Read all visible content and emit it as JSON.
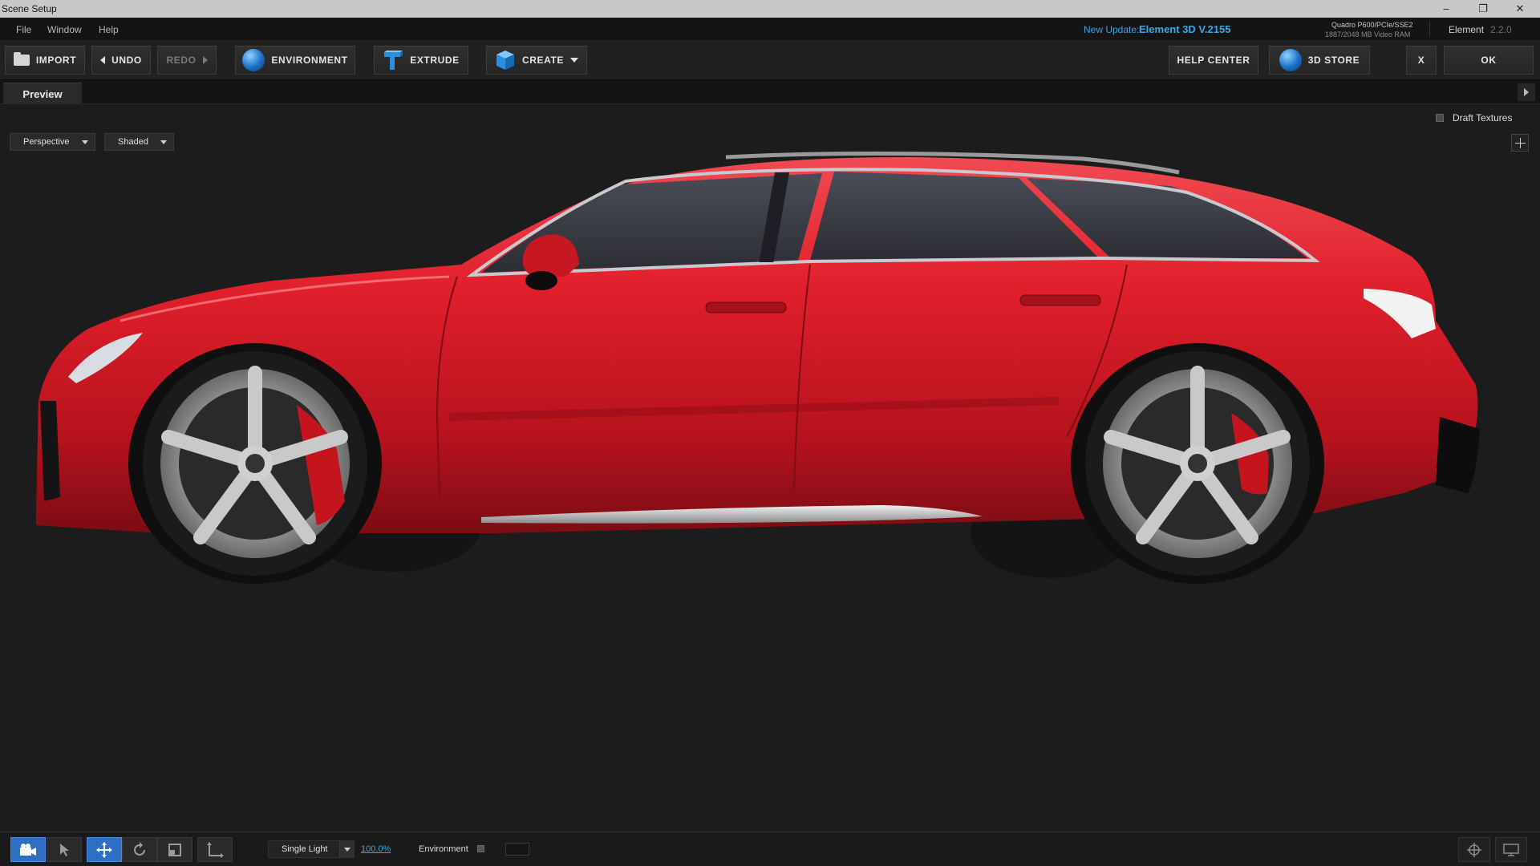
{
  "window": {
    "title": "Scene Setup",
    "minimize_symbol": "–",
    "restore_symbol": "❐",
    "close_symbol": "✕"
  },
  "menu": {
    "items": [
      "File",
      "Window",
      "Help"
    ],
    "update_label": "New Update:",
    "update_version": "Element 3D V.2155",
    "gpu_name": "Quadro P600/PCIe/SSE2",
    "gpu_ram": "1887/2048 MB Video RAM",
    "element_name": "Element",
    "element_version": "2.2.0"
  },
  "toolbar": {
    "import": "IMPORT",
    "undo": "UNDO",
    "redo": "REDO",
    "environment": "ENVIRONMENT",
    "extrude": "EXTRUDE",
    "create": "CREATE",
    "help_center": "HELP CENTER",
    "store": "3D STORE",
    "close": "X",
    "ok": "OK"
  },
  "tabs": {
    "preview": "Preview"
  },
  "viewport": {
    "draft_textures_label": "Draft Textures",
    "draft_textures_checked": false,
    "camera_view": "Perspective",
    "shading_mode": "Shaded",
    "car_body_color": "#d61b27"
  },
  "bottom": {
    "tools": [
      "camera-icon",
      "select-arrow-icon",
      "move-icon",
      "rotate-icon",
      "scale-icon",
      "axis-icon"
    ],
    "active_tool": "move-icon",
    "light_mode": "Single Light",
    "light_percent": "100.0%",
    "environment_label": "Environment",
    "environment_checked": false
  },
  "colors": {
    "accent_blue": "#3aa7e6",
    "active_tool": "#2d6fc2",
    "background": "#1c1c1c"
  }
}
